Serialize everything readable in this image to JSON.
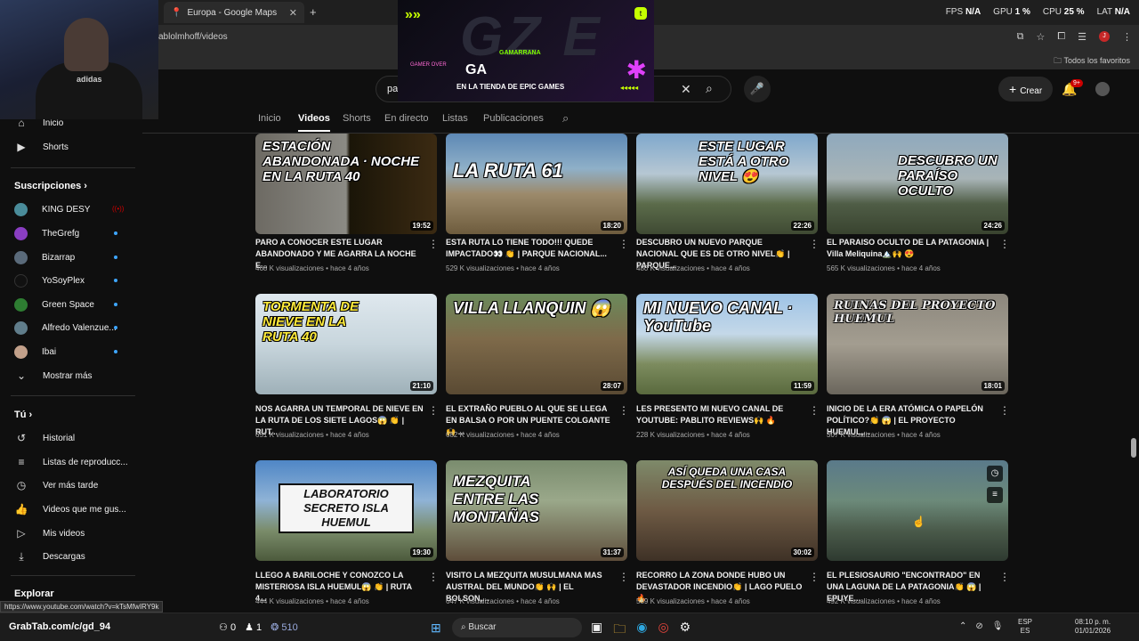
{
  "browser": {
    "tab_title": "Europa - Google Maps",
    "url": "ablolmhoff/videos",
    "perf": {
      "fps_label": "FPS",
      "fps_value": "N/A",
      "gpu_label": "GPU",
      "gpu_value": "1 %",
      "cpu_label": "CPU",
      "cpu_value": "25 %",
      "lat_label": "LAT",
      "lat_value": "N/A"
    },
    "favorites_label": "Todos los favoritos",
    "status_url": "https://www.youtube.com/watch?v=kTsMfwIRY9k"
  },
  "overlay": {
    "arrows": "»»",
    "brand": "GAMARRANA",
    "gamer_over": "GAMER OVER",
    "ga": "GA",
    "store_text": "EN LA TIENDA DE EPIC GAMES",
    "mini_arrows": "◂◂◂◂◂",
    "webcam_shirt": "adidas"
  },
  "header": {
    "search_value": "pa",
    "create_label": "Crear",
    "notif_count": "9+"
  },
  "channel_tabs": [
    "Inicio",
    "Videos",
    "Shorts",
    "En directo",
    "Listas",
    "Publicaciones"
  ],
  "active_tab": "Videos",
  "sidebar": {
    "top_items": [
      {
        "label": "Inicio",
        "icon": "home-icon"
      },
      {
        "label": "Shorts",
        "icon": "shorts-icon"
      }
    ],
    "subs_heading": "Suscripciones",
    "subscriptions": [
      {
        "label": "KING DESY",
        "color": "#4a8c9a",
        "status": "live"
      },
      {
        "label": "TheGrefg",
        "color": "#8a3ec2",
        "status": "dot"
      },
      {
        "label": "Bizarrap",
        "color": "#5a6a7a",
        "status": "dot"
      },
      {
        "label": "YoSoyPlex",
        "color": "#111111",
        "status": "dot"
      },
      {
        "label": "Green Space",
        "color": "#2e7d32",
        "status": "dot"
      },
      {
        "label": "Alfredo Valenzue...",
        "color": "#607d8b",
        "status": "dot"
      },
      {
        "label": "Ibai",
        "color": "#c2a08a",
        "status": "dot"
      }
    ],
    "show_more": "Mostrar más",
    "you_heading": "Tú",
    "you_items": [
      {
        "label": "Historial",
        "icon": "history-icon"
      },
      {
        "label": "Listas de reproducc...",
        "icon": "playlists-icon"
      },
      {
        "label": "Ver más tarde",
        "icon": "watch-later-icon"
      },
      {
        "label": "Videos que me gus...",
        "icon": "liked-icon"
      },
      {
        "label": "Mis videos",
        "icon": "my-videos-icon"
      },
      {
        "label": "Descargas",
        "icon": "downloads-icon"
      }
    ],
    "explore_heading": "Explorar"
  },
  "videos": [
    {
      "thumb_text": "ESTACIÓN ABANDONADA · NOCHE EN LA RUTA 40",
      "duration": "19:52",
      "title": "PARO A CONOCER ESTE LUGAR ABANDONADO Y ME AGARRA LA NOCHE E...",
      "meta": "468 K visualizaciones • hace 4 años",
      "bg": "linear-gradient(90deg,#6d6a63 0%,#8b8a84 50%,#1a1508 52%,#3b2a12 100%)"
    },
    {
      "thumb_text": "LA RUTA 61",
      "duration": "18:20",
      "title": "ESTA RUTA LO TIENE TODO!!! QUEDE IMPACTADO👀 👏 | PARQUE NACIONAL...",
      "meta": "529 K visualizaciones • hace 4 años",
      "bg": "linear-gradient(180deg,#5d88b5 0%,#8fb0c8 35%,#9c8a6b 60%,#6e5c3e 100%)"
    },
    {
      "thumb_text": "ESTE LUGAR ESTÁ A OTRO NIVEL 😍",
      "duration": "22:26",
      "title": "DESCUBRO UN NUEVO PARQUE NACIONAL QUE ES DE OTRO NIVEL👏 | PARQUE...",
      "meta": "480 K visualizaciones • hace 4 años",
      "bg": "linear-gradient(180deg,#7fa8cc 0%,#b6c7d3 40%,#5b6b4a 70%,#3f4a33 100%)"
    },
    {
      "thumb_text": "DESCUBRO UN PARAÍSO OCULTO",
      "duration": "24:26",
      "title": "EL PARAISO OCULTO DE LA PATAGONIA | Villa Meliquina🏔️🙌 😍",
      "meta": "565 K visualizaciones • hace 4 años",
      "bg": "linear-gradient(180deg,#8fa9bd 0%,#a8b4b7 45%,#4f5d46 70%,#39432f 100%)"
    },
    {
      "thumb_text": "TORMENTA DE NIEVE EN LA RUTA 40",
      "duration": "21:10",
      "title": "NOS AGARRA UN TEMPORAL DE NIEVE EN LA RUTA DE LOS SIETE LAGOS😱 👏 | RUT...",
      "meta": "651 K visualizaciones • hace 4 años",
      "bg": "linear-gradient(180deg,#dfe8ee 0%,#c8d6dd 50%,#9eb0b8 100%)"
    },
    {
      "thumb_text": "VILLA LLANQUIN 😱",
      "duration": "28:07",
      "title": "EL EXTRAÑO PUEBLO AL QUE SE LLEGA EN BALSA O POR UN PUENTE COLGANTE 🙌 ...",
      "meta": "682 K visualizaciones • hace 4 años",
      "bg": "linear-gradient(180deg,#6b8a5b 0%,#7e6a4a 45%,#5a4a33 100%)"
    },
    {
      "thumb_text": "MI NUEVO CANAL · YouTube",
      "duration": "11:59",
      "title": "LES PRESENTO MI NUEVO CANAL DE YOUTUBE: PABLITO REVIEWS🙌 🔥",
      "meta": "228 K visualizaciones • hace 4 años",
      "bg": "linear-gradient(180deg,#9ec3e6 0%,#c4d8e8 40%,#7c8b5e 70%,#5a6a3e 100%)"
    },
    {
      "thumb_text": "RUINAS DEL PROYECTO HUEMUL",
      "duration": "18:01",
      "title": "INICIO DE LA ERA ATÓMICA O PAPELÓN POLÍTICO?👏 😱 | EL PROYECTO HUEMUL,...",
      "meta": "307 K visualizaciones • hace 4 años",
      "bg": "linear-gradient(180deg,#8c877d 0%,#a39d90 50%,#6b665c 100%)"
    },
    {
      "thumb_text": "LABORATORIO SECRETO ISLA HUEMUL",
      "duration": "19:30",
      "title": "LLEGO A BARILOCHE Y CONOZCO LA MISTERIOSA ISLA HUEMUL😱 👏 | RUTA 4...",
      "meta": "444 K visualizaciones • hace 4 años",
      "bg": "linear-gradient(180deg,#4f86c6 0%,#8fb3d6 40%,#7a8c6a 70%,#4c5a3c 100%)"
    },
    {
      "thumb_text": "MEZQUITA ENTRE LAS MONTAÑAS",
      "duration": "31:37",
      "title": "VISITO LA MEZQUITA MUSULMANA MAS AUSTRAL DEL MUNDO👏 🙌 | EL BOLSON,...",
      "meta": "647 K visualizaciones • hace 4 años",
      "bg": "linear-gradient(180deg,#7a8c6e 0%,#9aa88a 40%,#5e4d3a 100%)"
    },
    {
      "thumb_text": "ASÍ QUEDA UNA CASA DESPUÉS DEL INCENDIO",
      "duration": "30:02",
      "title": "RECORRO LA ZONA DONDE HUBO UN DEVASTADOR INCENDIO👏 | LAGO PUELO🔥",
      "meta": "589 K visualizaciones • hace 4 años",
      "bg": "linear-gradient(180deg,#7e8a6a 0%,#6e5a44 50%,#3e3126 100%)"
    },
    {
      "thumb_text": "",
      "duration": "",
      "title": "EL PLESIOSAURIO \"ENCONTRADO\" EN UNA LAGUNA DE LA PATAGONIA👏 😱 | EPUYE...",
      "meta": "492 K visualizaciones • hace 4 años",
      "bg": "linear-gradient(180deg,#5a7a8a 0%,#6c8a7a 40%,#4a5a4a 70%,#2e3a30 100%)"
    }
  ],
  "taskbar": {
    "user": "GrabTab.com/c/gd_94",
    "stat1": "0",
    "stat2": "1",
    "stat3": "510",
    "search_label": "Buscar",
    "lang_top": "ESP",
    "lang_bottom": "ES",
    "time": "08:10 p. m.",
    "date": "01/01/2026"
  }
}
